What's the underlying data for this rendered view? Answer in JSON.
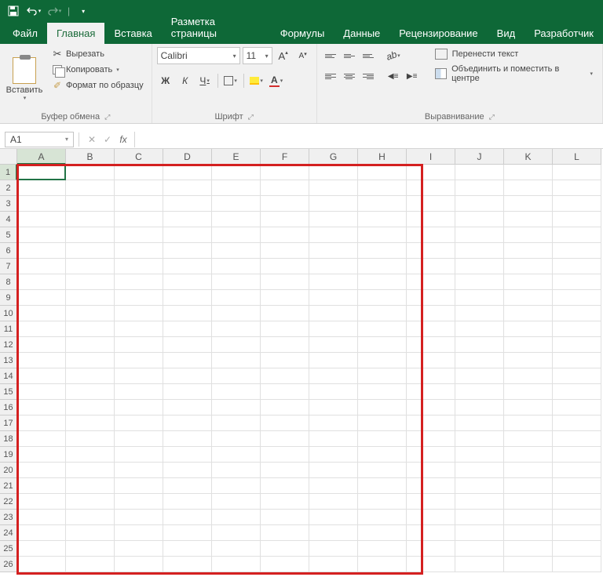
{
  "qat": {
    "save": "💾",
    "undo": "↶",
    "redo": "↷"
  },
  "tabs": {
    "file": "Файл",
    "home": "Главная",
    "insert": "Вставка",
    "layout": "Разметка страницы",
    "formulas": "Формулы",
    "data": "Данные",
    "review": "Рецензирование",
    "view": "Вид",
    "developer": "Разработчик"
  },
  "clipboard": {
    "paste": "Вставить",
    "cut": "Вырезать",
    "copy": "Копировать",
    "format_painter": "Формат по образцу",
    "group_label": "Буфер обмена"
  },
  "font": {
    "name": "Calibri",
    "size": "11",
    "bold": "Ж",
    "italic": "К",
    "underline": "Ч",
    "group_label": "Шрифт",
    "inc": "A",
    "dec": "A"
  },
  "alignment": {
    "wrap": "Перенести текст",
    "merge": "Объединить и поместить в центре",
    "group_label": "Выравнивание"
  },
  "name_box": "A1",
  "columns": [
    "A",
    "B",
    "C",
    "D",
    "E",
    "F",
    "G",
    "H",
    "I",
    "J",
    "K",
    "L"
  ],
  "rows": [
    1,
    2,
    3,
    4,
    5,
    6,
    7,
    8,
    9,
    10,
    11,
    12,
    13,
    14,
    15,
    16,
    17,
    18,
    19,
    20,
    21,
    22,
    23,
    24,
    25,
    26
  ],
  "selected_col": "A",
  "selected_row": 1
}
